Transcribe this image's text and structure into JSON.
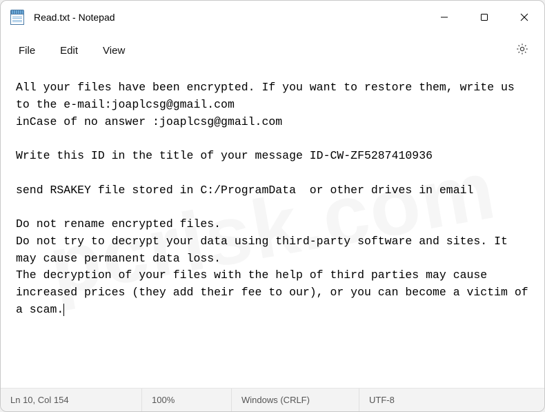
{
  "window": {
    "title": "Read.txt - Notepad"
  },
  "menu": {
    "file": "File",
    "edit": "Edit",
    "view": "View"
  },
  "document": {
    "text": "All your files have been encrypted. If you want to restore them, write us to the e-mail:joaplcsg@gmail.com\ninCase of no answer :joaplcsg@gmail.com\n\nWrite this ID in the title of your message ID-CW-ZF5287410936\n\nsend RSAKEY file stored in C:/ProgramData  or other drives in email\n\nDo not rename encrypted files.\nDo not try to decrypt your data using third-party software and sites. It may cause permanent data loss.\nThe decryption of your files with the help of third parties may cause increased prices (they add their fee to our), or you can become a victim of a scam."
  },
  "status": {
    "position": "Ln 10, Col 154",
    "zoom": "100%",
    "line_ending": "Windows (CRLF)",
    "encoding": "UTF-8"
  },
  "watermark": "pcrisk.com"
}
